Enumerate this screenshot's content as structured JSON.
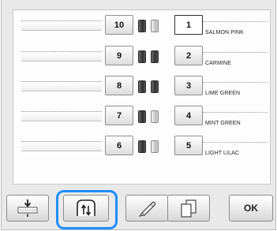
{
  "threads": {
    "left": [
      {
        "number": "10",
        "spool": "dark-light"
      },
      {
        "number": "9",
        "spool": "dark-dark"
      },
      {
        "number": "8",
        "spool": "dark-dark"
      },
      {
        "number": "7",
        "spool": "dark-light"
      },
      {
        "number": "6",
        "spool": "dark-light"
      }
    ],
    "right": [
      {
        "number": "1",
        "color_name": "SALMON PINK",
        "selected": true
      },
      {
        "number": "2",
        "color_name": "CARMINE",
        "selected": false
      },
      {
        "number": "3",
        "color_name": "LIME GREEN",
        "selected": false
      },
      {
        "number": "4",
        "color_name": "MINT GREEN",
        "selected": false
      },
      {
        "number": "5",
        "color_name": "LIGHT LILAC",
        "selected": false
      }
    ]
  },
  "toolbar": {
    "move_down_icon": "move-down-icon",
    "sort_order_icon": "sort-order-icon",
    "thread_pen_icon": "thread-pen-icon",
    "copy_icon": "copy-icon",
    "ok_label": "OK"
  },
  "colors": {
    "highlight": "#1f8fff",
    "spool_dark": "#2e2e2e",
    "spool_light": "#d6d6d6"
  }
}
